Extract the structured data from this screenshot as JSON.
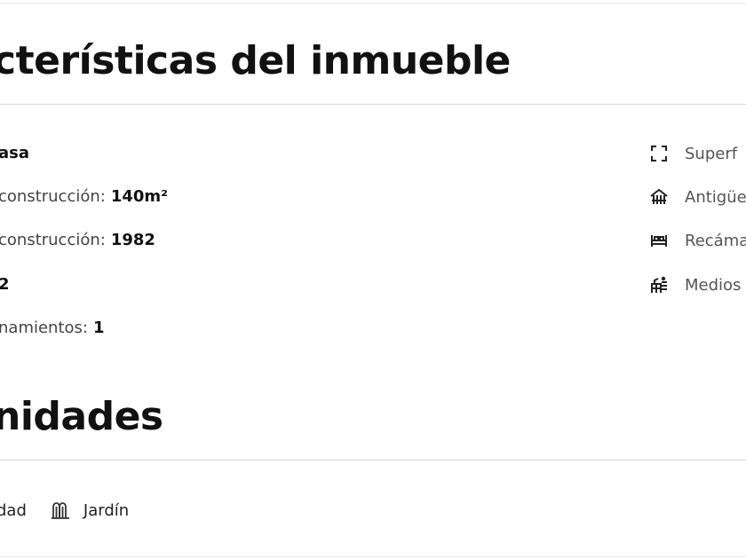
{
  "features_section": {
    "title": "cterísticas del inmueble",
    "rows": [
      {
        "label": "",
        "value": "asa"
      },
      {
        "label": " construcción:",
        "value": "140m²"
      },
      {
        "label": "construcción:",
        "value": "1982"
      },
      {
        "label": "",
        "value": "2"
      },
      {
        "label": "namientos:",
        "value": "1"
      }
    ],
    "right_items": [
      {
        "icon": "expand-icon",
        "label": "Superf"
      },
      {
        "icon": "house-icon",
        "label": "Antigüe"
      },
      {
        "icon": "bed-icon",
        "label": "Recáma"
      },
      {
        "icon": "bath-icon",
        "label": "Medios"
      }
    ]
  },
  "amenities_section": {
    "title": "nidades",
    "items": [
      {
        "icon": "",
        "label": "dad"
      },
      {
        "icon": "garden-icon",
        "label": "Jardín"
      }
    ]
  }
}
